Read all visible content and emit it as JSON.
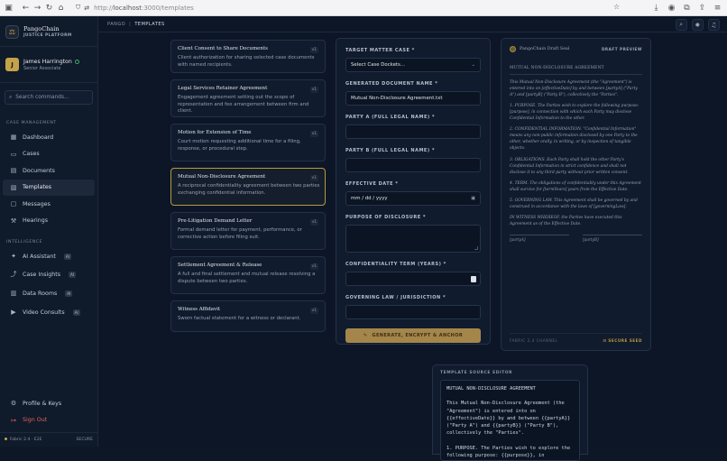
{
  "browser": {
    "url_prefix": "http://",
    "url_host": "localhost",
    "url_path": ":3000/templates"
  },
  "brand": {
    "name": "PangoChain",
    "sub": "JUSTICE PLATFORM",
    "logo_initial": "⚖"
  },
  "user": {
    "initial": "J",
    "name": "James Harrington",
    "role": "Senior Associate"
  },
  "search": {
    "placeholder": "Search commands..."
  },
  "sections": {
    "case_management": "CASE MANAGEMENT",
    "intelligence": "INTELLIGENCE"
  },
  "nav": {
    "dashboard": "Dashboard",
    "cases": "Cases",
    "documents": "Documents",
    "templates": "Templates",
    "messages": "Messages",
    "hearings": "Hearings",
    "ai_assistant": "AI Assistant",
    "case_insights": "Case Insights",
    "data_rooms": "Data Rooms",
    "video_consults": "Video Consults",
    "ai_badge": "AI"
  },
  "bottom": {
    "profile": "Profile & Keys",
    "signout": "Sign Out"
  },
  "status": {
    "left": "Fabric 2.4 · E2E",
    "right": "SECURE"
  },
  "breadcrumb": {
    "root": "PANGO",
    "current": "TEMPLATES"
  },
  "templates": [
    {
      "title": "Client Consent to Share Documents",
      "desc": "Client authorization for sharing selected case documents with named recipients.",
      "version": "v1"
    },
    {
      "title": "Legal Services Retainer Agreement",
      "desc": "Engagement agreement setting out the scope of representation and fee arrangement between firm and client.",
      "version": "v1"
    },
    {
      "title": "Motion for Extension of Time",
      "desc": "Court motion requesting additional time for a filing, response, or procedural step.",
      "version": "v1"
    },
    {
      "title": "Mutual Non-Disclosure Agreement",
      "desc": "A reciprocal confidentiality agreement between two parties exchanging confidential information.",
      "version": "v1"
    },
    {
      "title": "Pre-Litigation Demand Letter",
      "desc": "Formal demand letter for payment, performance, or corrective action before filing suit.",
      "version": "v1"
    },
    {
      "title": "Settlement Agreement & Release",
      "desc": "A full and final settlement and mutual release resolving a dispute between two parties.",
      "version": "v1"
    },
    {
      "title": "Witness Affidavit",
      "desc": "Sworn factual statement for a witness or declarant.",
      "version": "v1"
    }
  ],
  "form": {
    "target_case_label": "TARGET MATTER CASE *",
    "target_case_value": "Select Case Dockets...",
    "doc_name_label": "GENERATED DOCUMENT NAME *",
    "doc_name_value": "Mutual Non-Disclosure Agreement.txt",
    "party_a_label": "PARTY A (FULL LEGAL NAME) *",
    "party_b_label": "PARTY B (FULL LEGAL NAME) *",
    "date_label": "EFFECTIVE DATE *",
    "date_placeholder": "mm / dd / yyyy",
    "purpose_label": "PURPOSE OF DISCLOSURE *",
    "term_label": "CONFIDENTIALITY TERM (YEARS) *",
    "law_label": "GOVERNING LAW / JURISDICTION *",
    "generate_label": "GENERATE, ENCRYPT & ANCHOR"
  },
  "source": {
    "heading": "TEMPLATE SOURCE EDITOR",
    "code": "MUTUAL NON-DISCLOSURE AGREEMENT\n\nThis Mutual Non-Disclosure Agreement (the \"Agreement\") is entered into on {{effectiveDate}} by and between {{partyA}} (\"Party A\") and {{partyB}} (\"Party B\"), collectively the \"Parties\".\n\n1. PURPOSE. The Parties wish to explore the following purpose: {{purpose}}, in connection with which each Party may"
  },
  "preview": {
    "seal": "PangoChain Draft Seal",
    "label": "DRAFT PREVIEW",
    "title": "MUTUAL NON-DISCLOSURE AGREEMENT",
    "p1": "This Mutual Non-Disclosure Agreement (the \"Agreement\") is entered into on [effectiveDate] by and between [partyA] (\"Party A\") and [partyB] (\"Party B\"), collectively the \"Parties\".",
    "p2": "1. PURPOSE. The Parties wish to explore the following purpose: [purpose], in connection with which each Party may disclose Confidential Information to the other.",
    "p3": "2. CONFIDENTIAL INFORMATION. \"Confidential Information\" means any non-public information disclosed by one Party to the other, whether orally, in writing, or by inspection of tangible objects.",
    "p4": "3. OBLIGATIONS. Each Party shall hold the other Party's Confidential Information in strict confidence and shall not disclose it to any third party without prior written consent.",
    "p5": "4. TERM. The obligations of confidentiality under this Agreement shall survive for [termYears] years from the Effective Date.",
    "p6": "5. GOVERNING LAW. This Agreement shall be governed by and construed in accordance with the laws of [governingLaw].",
    "p7": "IN WITNESS WHEREOF, the Parties have executed this Agreement as of the Effective Date.",
    "sig_a": "[partyA]",
    "sig_b": "[partyB]",
    "footer_left": "FABRIC 2.4 CHANNEL",
    "footer_right": "SECURE SEED"
  }
}
